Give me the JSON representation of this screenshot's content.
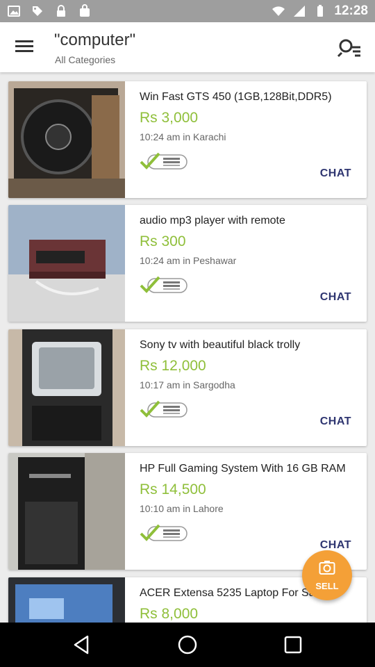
{
  "status_bar": {
    "time": "12:28",
    "left_icons": [
      "image-icon",
      "tag-icon",
      "lock-icon",
      "bag-icon"
    ],
    "right_icons": [
      "wifi-icon",
      "signal-icon",
      "battery-icon"
    ]
  },
  "header": {
    "title": "\"computer\"",
    "subtitle": "All Categories"
  },
  "listings": [
    {
      "title": "Win Fast GTS 450 (1GB,128Bit,DDR5)",
      "price": "Rs 3,000",
      "meta": "10:24 am in Karachi",
      "verified_label": "Phone Number Verified",
      "chat_label": "CHAT"
    },
    {
      "title": "audio mp3 player with remote",
      "price": "Rs 300",
      "meta": "10:24 am in Peshawar",
      "verified_label": "Phone Number Verified",
      "chat_label": "CHAT"
    },
    {
      "title": "Sony tv with beautiful black trolly",
      "price": "Rs 12,000",
      "meta": "10:17 am in Sargodha",
      "verified_label": "Phone Number Verified",
      "chat_label": "CHAT"
    },
    {
      "title": "HP Full Gaming System With 16 GB RAM",
      "price": "Rs 14,500",
      "meta": "10:10 am in Lahore",
      "verified_label": "Phone Number Verified",
      "chat_label": "CHAT"
    },
    {
      "title": "ACER Extensa 5235 Laptop For Sale",
      "price": "Rs 8,000",
      "meta": "",
      "verified_label": "",
      "chat_label": ""
    }
  ],
  "sell_button": {
    "label": "SELL"
  },
  "colors": {
    "price": "#8fbf3a",
    "chat": "#2e3570",
    "sell_fab": "#f4a037",
    "status_bar": "#9e9e9e"
  },
  "nav": {
    "icons": [
      "back-icon",
      "home-icon",
      "recents-icon"
    ]
  }
}
